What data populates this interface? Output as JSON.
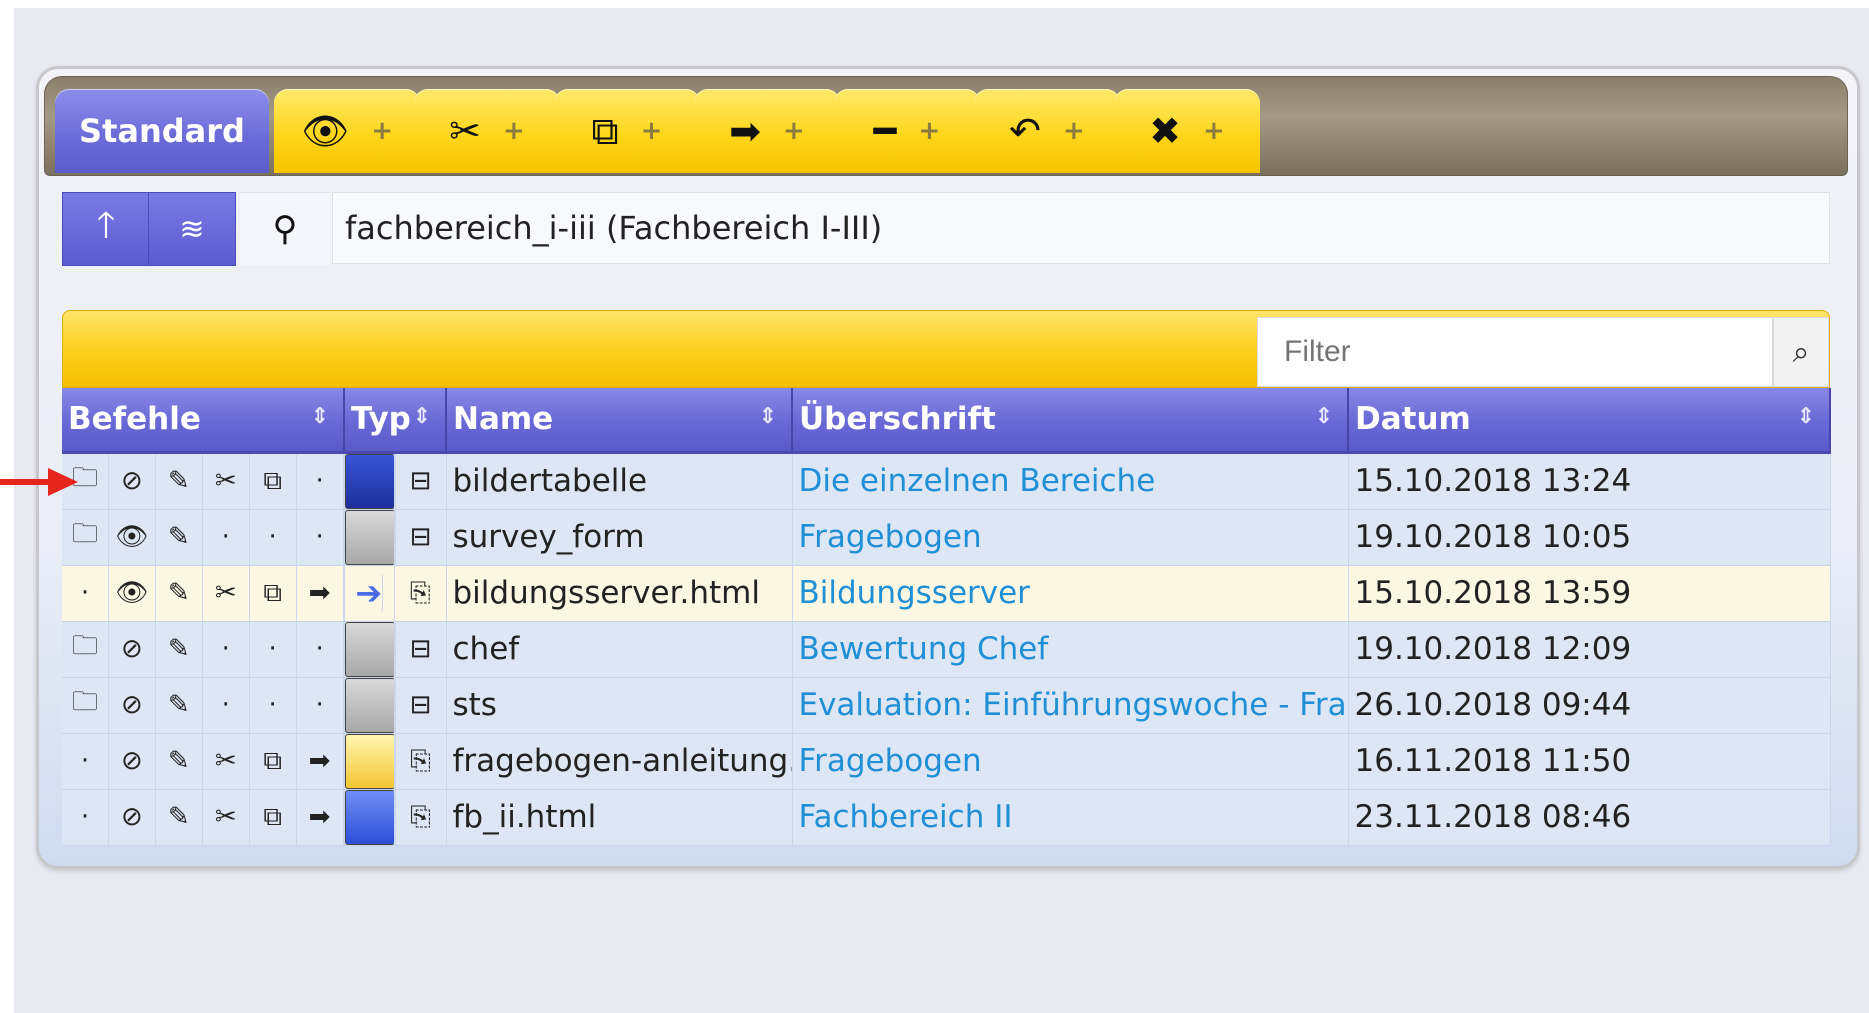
{
  "tabs": {
    "standard_label": "Standard",
    "action_tabs": [
      {
        "icon": "eye-icon",
        "glyph": "👁",
        "plus": "+"
      },
      {
        "icon": "scissors-icon",
        "glyph": "✂",
        "plus": "+"
      },
      {
        "icon": "copy-icon",
        "glyph": "⧉",
        "plus": "+"
      },
      {
        "icon": "arrow-right-icon",
        "glyph": "➡",
        "plus": "+"
      },
      {
        "icon": "minus-icon",
        "glyph": "━",
        "plus": "+"
      },
      {
        "icon": "undo-icon",
        "glyph": "↶",
        "plus": "+"
      },
      {
        "icon": "close-icon",
        "glyph": "✖",
        "plus": "+"
      }
    ]
  },
  "nav": {
    "path_text": "fachbereich_i-iii (Fachbereich I-III)"
  },
  "filter": {
    "placeholder": "Filter"
  },
  "table": {
    "headers": {
      "befehle": "Befehle",
      "typ": "Typ",
      "name": "Name",
      "ueberschrift": "Überschrift",
      "datum": "Datum"
    },
    "rows": [
      {
        "cmds": [
          "🗀",
          "⊘",
          "✎",
          "✂",
          "⧉",
          "·"
        ],
        "type": "table",
        "name": "bildertabelle",
        "ueberschrift": "Die einzelnen Bereiche",
        "datum": "15.10.2018 13:24"
      },
      {
        "cmds": [
          "🗀",
          "👁",
          "✎",
          "·",
          "·",
          "·"
        ],
        "type": "folder",
        "name": "survey_form",
        "ueberschrift": "Fragebogen",
        "datum": "19.10.2018 10:05"
      },
      {
        "cmds": [
          "·",
          "👁",
          "✎",
          "✂",
          "⧉",
          "➡"
        ],
        "type": "link",
        "name": "bildungsserver.html",
        "ueberschrift": "Bildungsserver",
        "datum": "15.10.2018 13:59"
      },
      {
        "cmds": [
          "🗀",
          "⊘",
          "✎",
          "·",
          "·",
          "·"
        ],
        "type": "folder",
        "name": "chef",
        "ueberschrift": "Bewertung Chef",
        "datum": "19.10.2018 12:09"
      },
      {
        "cmds": [
          "🗀",
          "⊘",
          "✎",
          "·",
          "·",
          "·"
        ],
        "type": "folder",
        "name": "sts",
        "ueberschrift": "Evaluation: Einführungswoche - Frankfurt",
        "datum": "26.10.2018 09:44"
      },
      {
        "cmds": [
          "·",
          "⊘",
          "✎",
          "✂",
          "⧉",
          "➡"
        ],
        "type": "pdf",
        "name": "fragebogen-anleitung.pdf",
        "ueberschrift": "Fragebogen",
        "datum": "16.11.2018 11:50"
      },
      {
        "cmds": [
          "·",
          "⊘",
          "✎",
          "✂",
          "⧉",
          "➡"
        ],
        "type": "html",
        "name": "fb_ii.html",
        "ueberschrift": "Fachbereich II",
        "datum": "23.11.2018 08:46"
      }
    ]
  }
}
